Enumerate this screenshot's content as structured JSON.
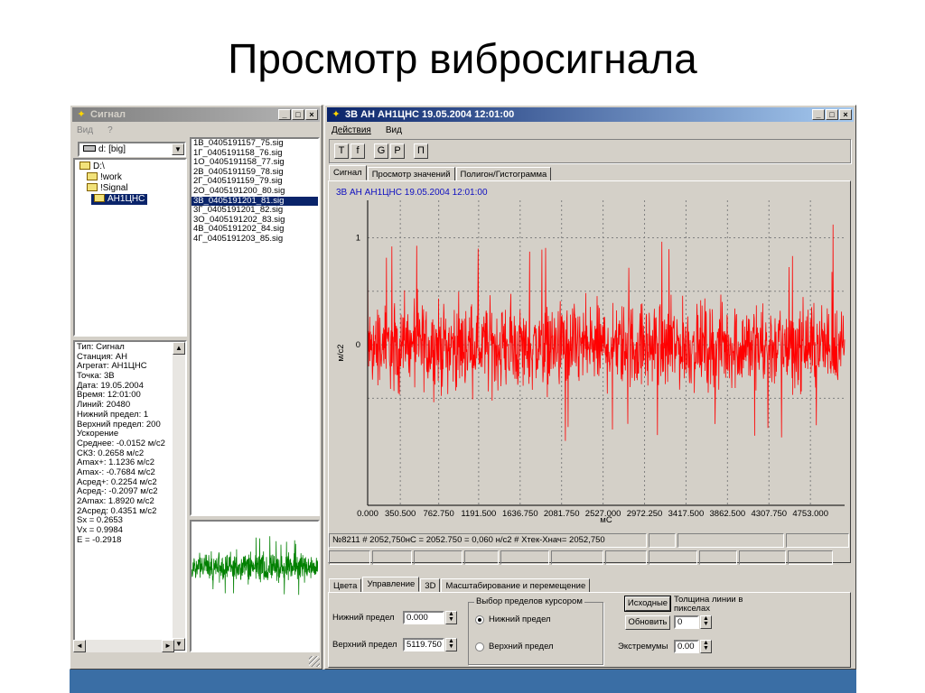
{
  "slide_title": "Просмотр вибросигнала",
  "colors": {
    "trace_main": "#ff0000",
    "trace_thumb": "#008000",
    "title_active": "#0a246a",
    "desktop": "#3a6ea5"
  },
  "left_window": {
    "title": "Сигнал",
    "menu": [
      "Вид",
      "?"
    ],
    "drive": "d: [big]",
    "tree": [
      {
        "label": "D:\\",
        "level": 0,
        "selected": false
      },
      {
        "label": "!work",
        "level": 1,
        "selected": false
      },
      {
        "label": "!Signal",
        "level": 1,
        "selected": false
      },
      {
        "label": "АН1ЦНС",
        "level": 2,
        "selected": true
      }
    ],
    "files": [
      {
        "name": "1В_0405191157_75.sig",
        "selected": false
      },
      {
        "name": "1Г_0405191158_76.sig",
        "selected": false
      },
      {
        "name": "1О_0405191158_77.sig",
        "selected": false
      },
      {
        "name": "2В_0405191159_78.sig",
        "selected": false
      },
      {
        "name": "2Г_0405191159_79.sig",
        "selected": false
      },
      {
        "name": "2О_0405191200_80.sig",
        "selected": false
      },
      {
        "name": "3В_0405191201_81.sig",
        "selected": true
      },
      {
        "name": "3Г_0405191201_82.sig",
        "selected": false
      },
      {
        "name": "3О_0405191202_83.sig",
        "selected": false
      },
      {
        "name": "4В_0405191202_84.sig",
        "selected": false
      },
      {
        "name": "4Г_0405191203_85.sig",
        "selected": false
      }
    ],
    "info": [
      "Тип: Сигнал",
      "Станция: АН",
      "Агрегат: АН1ЦНС",
      "Точка: 3В",
      "Дата: 19.05.2004",
      "Время: 12:01:00",
      "Линий: 20480",
      "Нижний предел: 1",
      "Верхний предел: 200",
      "Ускорение",
      "Среднее:  -0.0152 м/с2",
      "СКЗ:   0.2658 м/с2",
      "Amax+:   1.1236 м/с2",
      "Amax-:  -0.7684 м/с2",
      "Асред+:   0.2254 м/с2",
      "Асред-:  -0.2097 м/с2",
      "2Amax:   1.8920 м/с2",
      "2Асред:  0.4351 м/с2",
      "Sx =   0.2653",
      "Vx =   0.9984",
      "E  =  -0.2918"
    ]
  },
  "main_window": {
    "title": "3В АН АН1ЦНС 19.05.2004 12:01:00",
    "menu": [
      "Действия",
      "Вид"
    ],
    "toolbar": [
      "T",
      "f",
      "G",
      "P",
      "П"
    ],
    "tabs": [
      "Сигнал",
      "Просмотр значений",
      "Полигон/Гистограмма"
    ],
    "active_tab": 0,
    "status": "№8211  # 2052,750нС = 2052.750 = 0,060 н/с2  #  Хтек-Хнач= 2052,750",
    "bottom_tabs": [
      "Цвета",
      "Управление",
      "3D",
      "Масштабирование и перемещение"
    ],
    "bottom_active_tab": 1,
    "controls": {
      "lower_limit_label": "Нижний предел",
      "lower_limit_value": "0.000",
      "upper_limit_label": "Верхний предел",
      "upper_limit_value": "5119.750",
      "group_caption": "Выбор пределов курсором",
      "radio_lower": "Нижний предел",
      "radio_upper": "Верхний предел",
      "radio_selected": "lower",
      "btn_reset": "Исходные",
      "btn_refresh": "Обновить",
      "thickness_label": "Толщина линии в пикселах",
      "thickness_value": "0",
      "extrema_label": "Экстремумы",
      "extrema_value": "0.00"
    }
  },
  "chart_data": {
    "type": "line",
    "title": "3В АН АН1ЦНС 19.05.2004 12:01:00",
    "xlabel": "мС",
    "ylabel": "м/с2",
    "xlim": [
      0,
      5119.75
    ],
    "ylim": [
      -1.5,
      1.35
    ],
    "x_ticks": [
      "0.000",
      "350.500",
      "762.750",
      "1191.500",
      "1636.750",
      "2081.750",
      "2527.000",
      "2972.250",
      "3417.500",
      "3862.500",
      "4307.750",
      "4753.000"
    ],
    "y_ticks": [
      "1",
      "0"
    ],
    "grid": true,
    "series_stats": {
      "amax_plus": 1.1236,
      "amax_minus": -0.7684,
      "rms": 0.2658,
      "mean": -0.0152
    }
  }
}
